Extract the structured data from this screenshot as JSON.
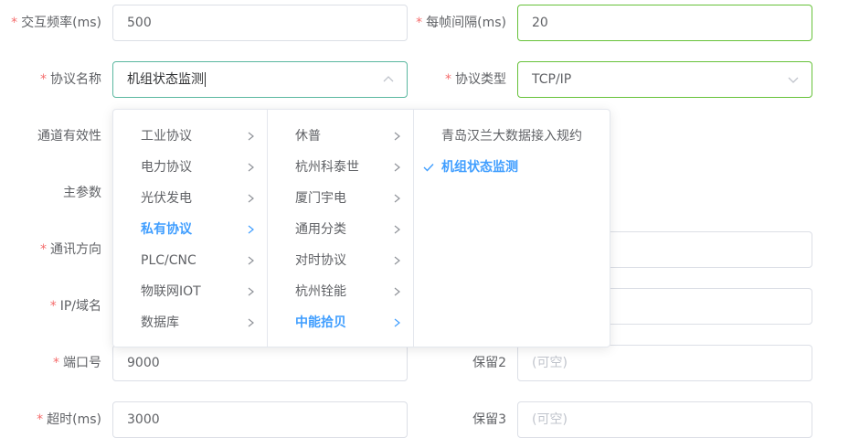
{
  "form": {
    "interaction_freq": {
      "label": "交互频率(ms)",
      "value": "500"
    },
    "frame_interval": {
      "label": "每帧间隔(ms)",
      "value": "20"
    },
    "protocol_name": {
      "label": "协议名称",
      "value": "机组状态监测"
    },
    "protocol_type": {
      "label": "协议类型",
      "value": "TCP/IP"
    },
    "channel_valid": {
      "label": "通道有效性"
    },
    "main_param": {
      "label": "主参数"
    },
    "comm_direction": {
      "label": "通讯方向"
    },
    "ip_domain": {
      "label": "IP/域名"
    },
    "port": {
      "label": "端口号",
      "value": "9000"
    },
    "reserve2": {
      "label": "保留2",
      "placeholder": "(可空)"
    },
    "timeout": {
      "label": "超时(ms)",
      "value": "3000"
    },
    "reserve3": {
      "label": "保留3",
      "placeholder": "(可空)"
    }
  },
  "cascader": {
    "level1": [
      "工业协议",
      "电力协议",
      "光伏发电",
      "私有协议",
      "PLC/CNC",
      "物联网IOT",
      "数据库"
    ],
    "level2": [
      "休普",
      "杭州科泰世",
      "厦门宇电",
      "通用分类",
      "对时协议",
      "杭州铨能",
      "中能拾贝"
    ],
    "level3": [
      "青岛汉兰大数据接入规约",
      "机组状态监测"
    ]
  },
  "colors": {
    "active": "#409eff",
    "required": "#f56c6c",
    "valid_border": "#67c23a"
  }
}
